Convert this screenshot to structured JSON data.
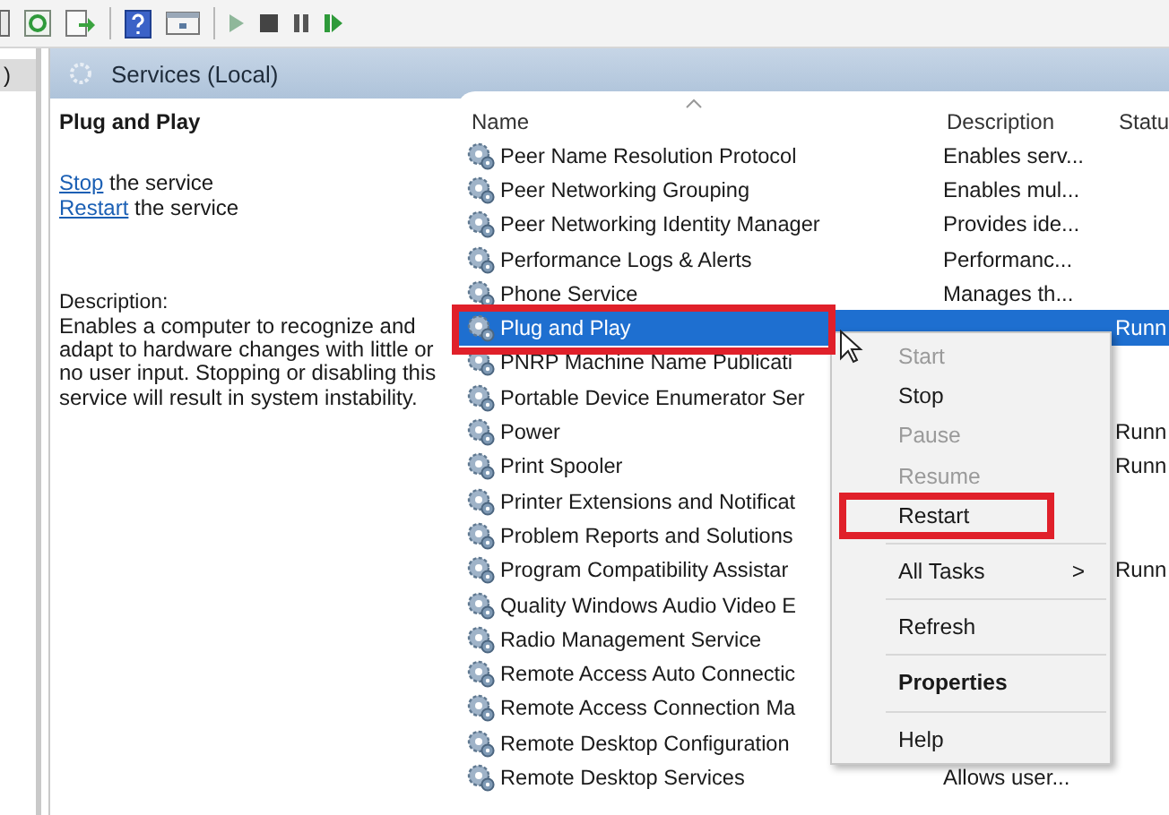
{
  "tree": {
    "item": ")"
  },
  "panel_title": "Services (Local)",
  "details": {
    "title": "Plug and Play",
    "actions": [
      {
        "link": "Stop",
        "text": " the service"
      },
      {
        "link": "Restart",
        "text": " the service"
      }
    ],
    "description_label": "Description:",
    "description": "Enables a computer to recognize and adapt to hardware changes with little or no user input. Stopping or disabling this service will result in system instability."
  },
  "columns": [
    "Name",
    "Description",
    "Statu"
  ],
  "rows": [
    {
      "name": "Peer Name Resolution Protocol",
      "description": "Enables serv...",
      "status": "",
      "selected": false
    },
    {
      "name": "Peer Networking Grouping",
      "description": "Enables mul...",
      "status": "",
      "selected": false
    },
    {
      "name": "Peer Networking Identity Manager",
      "description": "Provides ide...",
      "status": "",
      "selected": false
    },
    {
      "name": "Performance Logs & Alerts",
      "description": "Performanc...",
      "status": "",
      "selected": false
    },
    {
      "name": "Phone Service",
      "description": "Manages th...",
      "status": "",
      "selected": false
    },
    {
      "name": "Plug and Play",
      "description": "",
      "status": "Runn",
      "selected": true
    },
    {
      "name": "PNRP Machine Name Publicati",
      "description": "",
      "status": "",
      "selected": false
    },
    {
      "name": "Portable Device Enumerator Ser",
      "description": "",
      "status": "",
      "selected": false
    },
    {
      "name": "Power",
      "description": "",
      "status": "Runn",
      "selected": false
    },
    {
      "name": "Print Spooler",
      "description": "",
      "status": "Runn",
      "selected": false
    },
    {
      "name": "Printer Extensions and Notificat",
      "description": "",
      "status": "",
      "selected": false
    },
    {
      "name": "Problem Reports and Solutions",
      "description": "",
      "status": "",
      "selected": false
    },
    {
      "name": "Program Compatibility Assistar",
      "description": "",
      "status": "Runn",
      "selected": false
    },
    {
      "name": "Quality Windows Audio Video E",
      "description": "",
      "status": "",
      "selected": false
    },
    {
      "name": "Radio Management Service",
      "description": "",
      "status": "",
      "selected": false
    },
    {
      "name": "Remote Access Auto Connectic",
      "description": "",
      "status": "",
      "selected": false
    },
    {
      "name": "Remote Access Connection Ma",
      "description": "",
      "status": "",
      "selected": false
    },
    {
      "name": "Remote Desktop Configuration",
      "description": "",
      "status": "",
      "selected": false
    },
    {
      "name": "Remote Desktop Services",
      "description": "Allows user...",
      "status": "",
      "selected": false
    }
  ],
  "context_menu": [
    {
      "kind": "item",
      "label": "Start",
      "disabled": true
    },
    {
      "kind": "item",
      "label": "Stop",
      "disabled": false
    },
    {
      "kind": "item",
      "label": "Pause",
      "disabled": true
    },
    {
      "kind": "item",
      "label": "Resume",
      "disabled": true
    },
    {
      "kind": "item",
      "label": "Restart",
      "disabled": false
    },
    {
      "kind": "separator"
    },
    {
      "kind": "submenu",
      "label": "All Tasks",
      "arrow": ">",
      "disabled": false
    },
    {
      "kind": "separator"
    },
    {
      "kind": "item",
      "label": "Refresh",
      "disabled": false
    },
    {
      "kind": "separator"
    },
    {
      "kind": "default",
      "label": "Properties",
      "disabled": false
    },
    {
      "kind": "separator"
    },
    {
      "kind": "item",
      "label": "Help",
      "disabled": false
    }
  ]
}
